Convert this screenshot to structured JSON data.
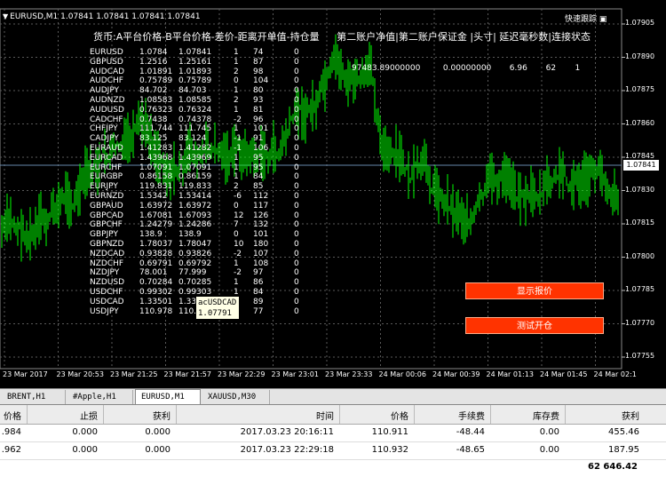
{
  "chart_title": "EURUSD,M1  1.07841 1.07841 1.07841 1.07841",
  "top_right_label": "快速跟踪",
  "header": [
    "货币:A平台价格-B平台价格-差价-距离开单值-持仓量",
    "第二账户净值|第二账户保证金 |头寸| 延迟毫秒数|连接状态"
  ],
  "account": [
    "97483.89000000",
    "0.00000000",
    "6.96",
    "62",
    "1"
  ],
  "rows": [
    [
      "EURUSD",
      "1.0784",
      "1.07841",
      "1",
      "74",
      "0"
    ],
    [
      "GBPUSD",
      "1.2516",
      "1.25161",
      "1",
      "87",
      "0"
    ],
    [
      "AUDCAD",
      "1.01891",
      "1.01893",
      "2",
      "98",
      "0"
    ],
    [
      "AUDCHF",
      "0.75789",
      "0.75789",
      "0",
      "104",
      "0"
    ],
    [
      "AUDJPY",
      "84.702",
      "84.703",
      "1",
      "80",
      "0"
    ],
    [
      "AUDNZD",
      "1.08583",
      "1.08585",
      "2",
      "93",
      "0"
    ],
    [
      "AUDUSD",
      "0.76323",
      "0.76324",
      "1",
      "81",
      "0"
    ],
    [
      "CADCHF",
      "0.7438",
      "0.74378",
      "-2",
      "96",
      "0"
    ],
    [
      "CHFJPY",
      "111.744",
      "111.745",
      "1",
      "101",
      "0"
    ],
    [
      "CADJPY",
      "83.125",
      "83.124",
      "-1",
      "91",
      "0"
    ],
    [
      "EURAUD",
      "1.41283",
      "1.41282",
      "-1",
      "106",
      "0"
    ],
    [
      "EURCAD",
      "1.43968",
      "1.43969",
      "1",
      "95",
      "0"
    ],
    [
      "EURCHF",
      "1.07091",
      "1.07091",
      "1",
      "95",
      "0"
    ],
    [
      "EURGBP",
      "0.86158",
      "0.86159",
      "1",
      "84",
      "0"
    ],
    [
      "EURJPY",
      "119.831",
      "119.833",
      "2",
      "85",
      "0"
    ],
    [
      "EURNZD",
      "1.5342",
      "1.53414",
      "-6",
      "112",
      "0"
    ],
    [
      "GBPAUD",
      "1.63972",
      "1.63972",
      "0",
      "117",
      "0"
    ],
    [
      "GBPCAD",
      "1.67081",
      "1.67093",
      "12",
      "126",
      "0"
    ],
    [
      "GBPCHF",
      "1.24279",
      "1.24286",
      "7",
      "132",
      "0"
    ],
    [
      "GBPJPY",
      "138.9",
      "138.9",
      "0",
      "101",
      "0"
    ],
    [
      "GBPNZD",
      "1.78037",
      "1.78047",
      "10",
      "180",
      "0"
    ],
    [
      "NZDCAD",
      "0.93828",
      "0.93826",
      "-2",
      "107",
      "0"
    ],
    [
      "NZDCHF",
      "0.69791",
      "0.69792",
      "1",
      "108",
      "0"
    ],
    [
      "NZDJPY",
      "78.001",
      "77.999",
      "-2",
      "97",
      "0"
    ],
    [
      "NZDUSD",
      "0.70284",
      "0.70285",
      "1",
      "86",
      "0"
    ],
    [
      "USDCHF",
      "0.99302",
      "0.99303",
      "1",
      "84",
      "0"
    ],
    [
      "USDCAD",
      "1.33501",
      "1.33502",
      "1",
      "89",
      "0"
    ],
    [
      "USDJPY",
      "110.978",
      "110.979",
      "1",
      "77",
      "0"
    ]
  ],
  "buttons": {
    "show_quote": "显示报价",
    "test_open": "测试开仓"
  },
  "tooltip": {
    "name": "acUSDCAD",
    "value": "1.07791"
  },
  "price_axis": [
    "1.07905",
    "1.07890",
    "1.07875",
    "1.07860",
    "1.07845",
    "1.07830",
    "1.07815",
    "1.07800",
    "1.07785",
    "1.07770",
    "1.07755"
  ],
  "current_price": "1.07841",
  "time_axis": [
    "23 Mar 2017",
    "23 Mar 20:53",
    "23 Mar 21:25",
    "23 Mar 21:57",
    "23 Mar 22:29",
    "23 Mar 23:01",
    "23 Mar 23:33",
    "24 Mar 00:06",
    "24 Mar 00:39",
    "24 Mar 01:13",
    "24 Mar 01:45",
    "24 Mar 02:1"
  ],
  "tabs": [
    "BRENT,H1",
    "#Apple,H1",
    "EURUSD,M1",
    "XAUUSD,M30"
  ],
  "active_tab": 2,
  "table": {
    "headers": [
      "价格",
      "止损",
      "获利",
      "时间",
      "价格",
      "手续费",
      "库存费",
      "获利"
    ],
    "rows": [
      [
        ".984",
        "0.000",
        "0.000",
        "2017.03.23 20:16:11",
        "110.911",
        "-48.44",
        "0.00",
        "455.46"
      ],
      [
        ".962",
        "0.000",
        "0.000",
        "2017.03.23 22:29:18",
        "110.932",
        "-48.65",
        "0.00",
        "187.95"
      ]
    ],
    "balance": "62 646.42"
  },
  "colors": {
    "candle": "#00ff00",
    "grid": "#5a5a5a",
    "button": "#ff3300"
  }
}
